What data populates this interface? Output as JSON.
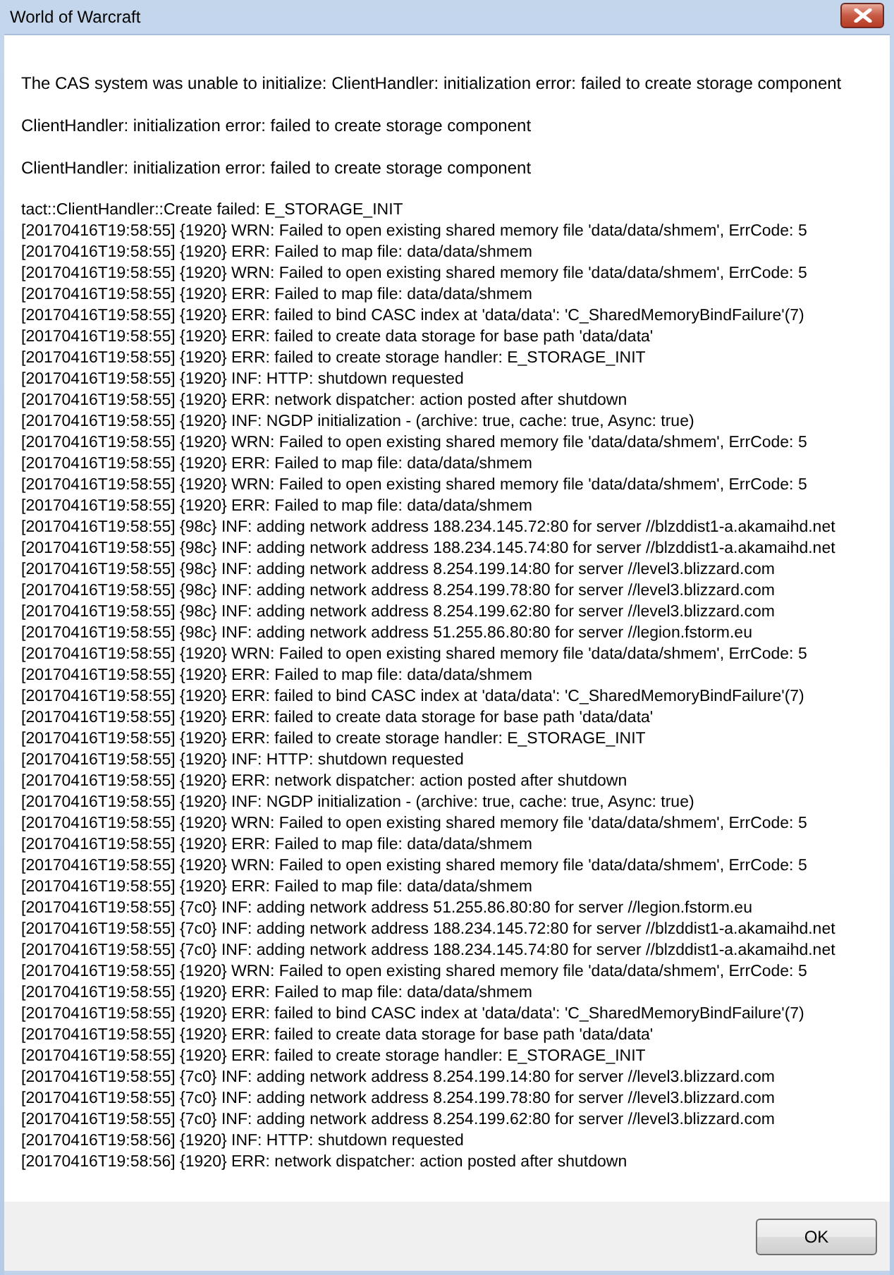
{
  "window": {
    "title": "World of Warcraft"
  },
  "paragraphs": [
    "The CAS system was unable to initialize: ClientHandler: initialization error: failed to create storage component",
    "ClientHandler: initialization error: failed to create storage component",
    "ClientHandler: initialization error: failed to create storage component"
  ],
  "log": [
    "tact::ClientHandler::Create failed: E_STORAGE_INIT",
    "[20170416T19:58:55] {1920} WRN: Failed to open existing shared memory file 'data/data/shmem', ErrCode: 5",
    "[20170416T19:58:55] {1920} ERR: Failed to map file: data/data/shmem",
    "[20170416T19:58:55] {1920} WRN: Failed to open existing shared memory file 'data/data/shmem', ErrCode: 5",
    "[20170416T19:58:55] {1920} ERR: Failed to map file: data/data/shmem",
    "[20170416T19:58:55] {1920} ERR: failed to bind CASC index at 'data/data': 'C_SharedMemoryBindFailure'(7)",
    "[20170416T19:58:55] {1920} ERR: failed to create data storage for base path 'data/data'",
    "[20170416T19:58:55] {1920} ERR: failed to create storage handler: E_STORAGE_INIT",
    "[20170416T19:58:55] {1920} INF: HTTP: shutdown requested",
    "[20170416T19:58:55] {1920} ERR: network dispatcher: action posted after shutdown",
    "[20170416T19:58:55] {1920} INF: NGDP initialization - (archive: true, cache: true, Async: true)",
    "[20170416T19:58:55] {1920} WRN: Failed to open existing shared memory file 'data/data/shmem', ErrCode: 5",
    "[20170416T19:58:55] {1920} ERR: Failed to map file: data/data/shmem",
    "[20170416T19:58:55] {1920} WRN: Failed to open existing shared memory file 'data/data/shmem', ErrCode: 5",
    "[20170416T19:58:55] {1920} ERR: Failed to map file: data/data/shmem",
    "[20170416T19:58:55] {98c} INF: adding network address 188.234.145.72:80 for server //blzddist1-a.akamaihd.net",
    "[20170416T19:58:55] {98c} INF: adding network address 188.234.145.74:80 for server //blzddist1-a.akamaihd.net",
    "[20170416T19:58:55] {98c} INF: adding network address 8.254.199.14:80 for server //level3.blizzard.com",
    "[20170416T19:58:55] {98c} INF: adding network address 8.254.199.78:80 for server //level3.blizzard.com",
    "[20170416T19:58:55] {98c} INF: adding network address 8.254.199.62:80 for server //level3.blizzard.com",
    "[20170416T19:58:55] {98c} INF: adding network address 51.255.86.80:80 for server //legion.fstorm.eu",
    "[20170416T19:58:55] {1920} WRN: Failed to open existing shared memory file 'data/data/shmem', ErrCode: 5",
    "[20170416T19:58:55] {1920} ERR: Failed to map file: data/data/shmem",
    "[20170416T19:58:55] {1920} ERR: failed to bind CASC index at 'data/data': 'C_SharedMemoryBindFailure'(7)",
    "[20170416T19:58:55] {1920} ERR: failed to create data storage for base path 'data/data'",
    "[20170416T19:58:55] {1920} ERR: failed to create storage handler: E_STORAGE_INIT",
    "[20170416T19:58:55] {1920} INF: HTTP: shutdown requested",
    "[20170416T19:58:55] {1920} ERR: network dispatcher: action posted after shutdown",
    "[20170416T19:58:55] {1920} INF: NGDP initialization - (archive: true, cache: true, Async: true)",
    "[20170416T19:58:55] {1920} WRN: Failed to open existing shared memory file 'data/data/shmem', ErrCode: 5",
    "[20170416T19:58:55] {1920} ERR: Failed to map file: data/data/shmem",
    "[20170416T19:58:55] {1920} WRN: Failed to open existing shared memory file 'data/data/shmem', ErrCode: 5",
    "[20170416T19:58:55] {1920} ERR: Failed to map file: data/data/shmem",
    "[20170416T19:58:55] {7c0} INF: adding network address 51.255.86.80:80 for server //legion.fstorm.eu",
    "[20170416T19:58:55] {7c0} INF: adding network address 188.234.145.72:80 for server //blzddist1-a.akamaihd.net",
    "[20170416T19:58:55] {7c0} INF: adding network address 188.234.145.74:80 for server //blzddist1-a.akamaihd.net",
    "[20170416T19:58:55] {1920} WRN: Failed to open existing shared memory file 'data/data/shmem', ErrCode: 5",
    "[20170416T19:58:55] {1920} ERR: Failed to map file: data/data/shmem",
    "[20170416T19:58:55] {1920} ERR: failed to bind CASC index at 'data/data': 'C_SharedMemoryBindFailure'(7)",
    "[20170416T19:58:55] {1920} ERR: failed to create data storage for base path 'data/data'",
    "[20170416T19:58:55] {1920} ERR: failed to create storage handler: E_STORAGE_INIT",
    "[20170416T19:58:55] {7c0} INF: adding network address 8.254.199.14:80 for server //level3.blizzard.com",
    "[20170416T19:58:55] {7c0} INF: adding network address 8.254.199.78:80 for server //level3.blizzard.com",
    "[20170416T19:58:55] {7c0} INF: adding network address 8.254.199.62:80 for server //level3.blizzard.com",
    "[20170416T19:58:56] {1920} INF: HTTP: shutdown requested",
    "[20170416T19:58:56] {1920} ERR: network dispatcher: action posted after shutdown"
  ],
  "buttons": [
    "OK"
  ]
}
